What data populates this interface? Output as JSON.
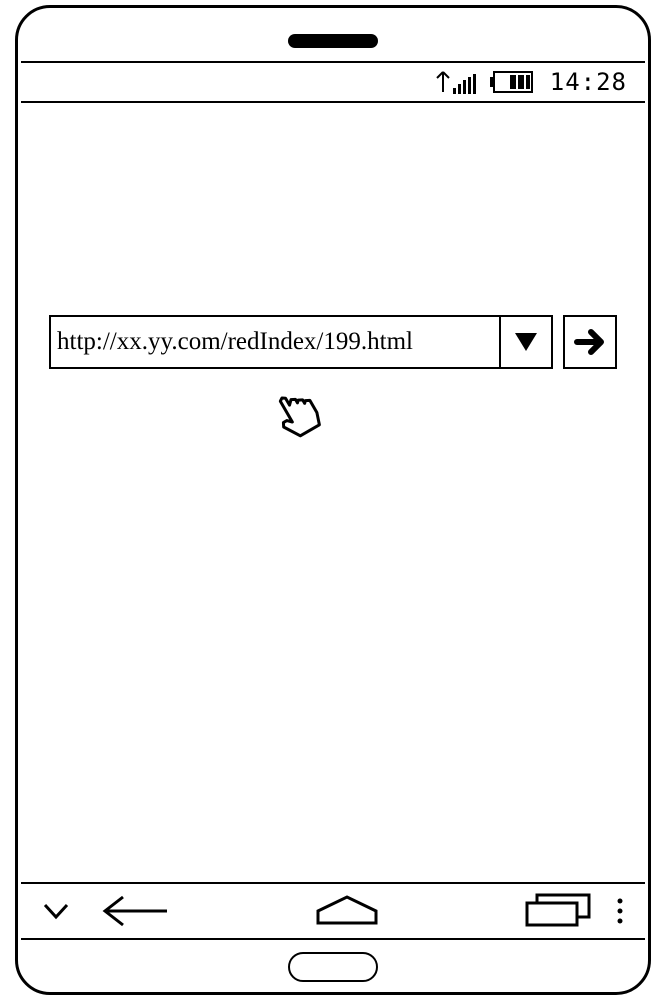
{
  "status": {
    "time": "14:28"
  },
  "browser": {
    "url": "http://xx.yy.com/redIndex/199.html"
  }
}
